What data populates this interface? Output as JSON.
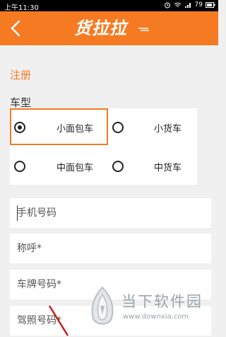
{
  "status": {
    "time": "上午11:30",
    "battery": "79"
  },
  "header": {
    "brand": "货拉拉"
  },
  "register": {
    "title": "注册"
  },
  "car_type": {
    "label": "车型",
    "options": [
      {
        "label": "小面包车",
        "selected": true
      },
      {
        "label": "小货车",
        "selected": false
      },
      {
        "label": "中面包车",
        "selected": false
      },
      {
        "label": "中货车",
        "selected": false
      }
    ]
  },
  "fields": {
    "phone": {
      "placeholder": "手机号码"
    },
    "name": {
      "placeholder": "称呼*"
    },
    "plate": {
      "placeholder": "车牌号码*"
    },
    "license": {
      "placeholder": "驾照号码*"
    }
  },
  "watermark": {
    "name": "当下软件园",
    "url": "www.downxia.com"
  },
  "colors": {
    "accent": "#f57a22",
    "background": "#f0f0f0"
  }
}
